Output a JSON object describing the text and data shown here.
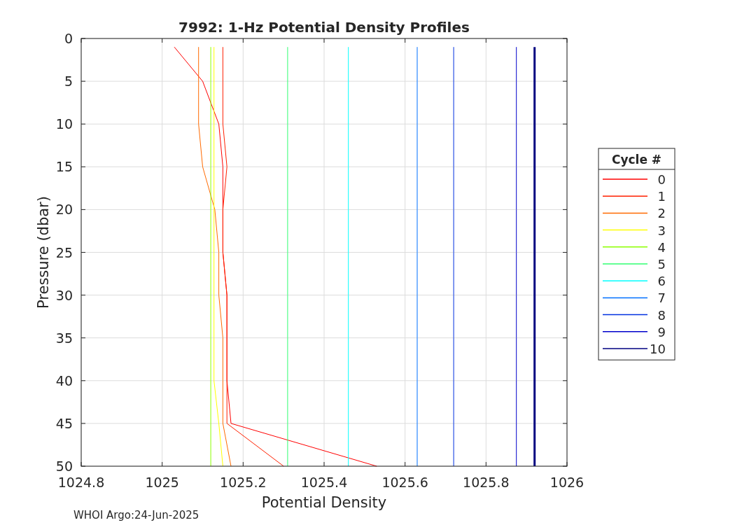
{
  "figure": {
    "footer": "WHOI Argo:24-Jun-2025",
    "chart_data": {
      "type": "line",
      "title": "7992: 1-Hz Potential Density Profiles",
      "xlabel": "Potential Density",
      "ylabel": "Pressure (dbar)",
      "orientation": "horizontal",
      "grid": true,
      "legend": true,
      "legend_title": "Cycle #",
      "x": [
        1,
        5,
        10,
        15,
        20,
        25,
        30,
        35,
        40,
        45,
        50
      ],
      "xlim": [
        1024.8,
        1026
      ],
      "ylim": [
        50,
        0
      ],
      "xticks": [
        1024.8,
        1025,
        1025.2,
        1025.4,
        1025.6,
        1025.8,
        1026
      ],
      "yticks": [
        0,
        5,
        10,
        15,
        20,
        25,
        30,
        35,
        40,
        45,
        50
      ],
      "series": [
        {
          "name": "0",
          "color": "#ff0000",
          "values": [
            1025.03,
            1025.1,
            1025.14,
            1025.15,
            1025.15,
            1025.15,
            1025.16,
            1025.16,
            1025.16,
            1025.17,
            1025.53
          ]
        },
        {
          "name": "1",
          "color": "#ff2000",
          "values": [
            1025.15,
            1025.15,
            1025.15,
            1025.16,
            1025.15,
            1025.15,
            1025.16,
            1025.16,
            1025.16,
            1025.16,
            1025.3
          ]
        },
        {
          "name": "2",
          "color": "#ff6a00",
          "values": [
            1025.09,
            1025.09,
            1025.09,
            1025.1,
            1025.13,
            1025.14,
            1025.14,
            1025.15,
            1025.15,
            1025.15,
            1025.17
          ]
        },
        {
          "name": "3",
          "color": "#ffff00",
          "values": [
            1025.128,
            1025.128,
            1025.128,
            1025.128,
            1025.128,
            1025.128,
            1025.128,
            1025.128,
            1025.128,
            1025.14,
            1025.15
          ]
        },
        {
          "name": "4",
          "color": "#8cff00",
          "values": [
            1025.12,
            1025.12,
            1025.12,
            1025.12,
            1025.12,
            1025.12,
            1025.12,
            1025.12,
            1025.12,
            1025.12,
            1025.12
          ]
        },
        {
          "name": "5",
          "color": "#30ff70",
          "values": [
            1025.31,
            1025.31,
            1025.31,
            1025.31,
            1025.31,
            1025.31,
            1025.31,
            1025.31,
            1025.31,
            1025.31,
            1025.31
          ]
        },
        {
          "name": "6",
          "color": "#00ffff",
          "values": [
            1025.46,
            1025.46,
            1025.46,
            1025.46,
            1025.46,
            1025.46,
            1025.46,
            1025.46,
            1025.46,
            1025.46,
            1025.46
          ]
        },
        {
          "name": "7",
          "color": "#0070ff",
          "values": [
            1025.63,
            1025.63,
            1025.63,
            1025.63,
            1025.63,
            1025.63,
            1025.63,
            1025.63,
            1025.63,
            1025.63,
            1025.63
          ]
        },
        {
          "name": "8",
          "color": "#0030e0",
          "values": [
            1025.72,
            1025.72,
            1025.72,
            1025.72,
            1025.72,
            1025.72,
            1025.72,
            1025.72,
            1025.72,
            1025.72,
            1025.72
          ]
        },
        {
          "name": "9",
          "color": "#0000cc",
          "values": [
            1025.875,
            1025.875,
            1025.875,
            1025.875,
            1025.875,
            1025.875,
            1025.875,
            1025.875,
            1025.875,
            1025.875,
            1025.875
          ]
        },
        {
          "name": "10",
          "color": "#000080",
          "values": [
            1025.92,
            1025.92,
            1025.92,
            1025.92,
            1025.92,
            1025.92,
            1025.92,
            1025.92,
            1025.92,
            1025.92,
            1025.92
          ]
        }
      ]
    }
  }
}
